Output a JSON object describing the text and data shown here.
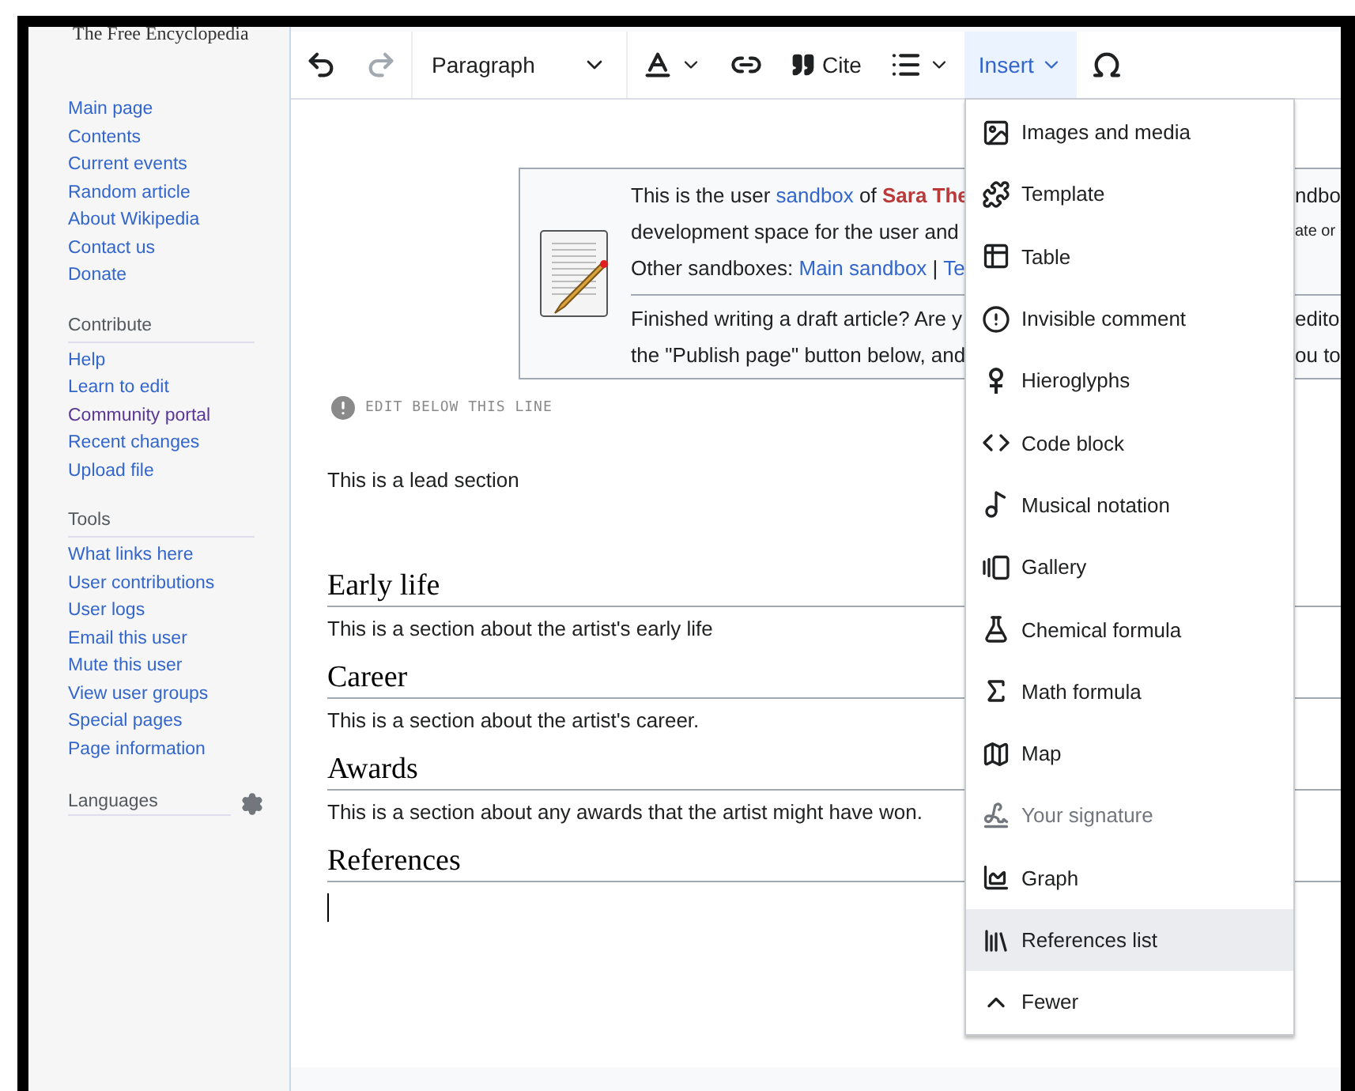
{
  "sidebar": {
    "logo_text": "The Free Encyclopedia",
    "groups": [
      {
        "items": [
          {
            "label": "Main page",
            "visited": false
          },
          {
            "label": "Contents",
            "visited": false
          },
          {
            "label": "Current events",
            "visited": false
          },
          {
            "label": "Random article",
            "visited": false
          },
          {
            "label": "About Wikipedia",
            "visited": false
          },
          {
            "label": "Contact us",
            "visited": false
          },
          {
            "label": "Donate",
            "visited": false
          }
        ]
      },
      {
        "heading": "Contribute",
        "items": [
          {
            "label": "Help",
            "visited": false
          },
          {
            "label": "Learn to edit",
            "visited": false
          },
          {
            "label": "Community portal",
            "visited": true
          },
          {
            "label": "Recent changes",
            "visited": false
          },
          {
            "label": "Upload file",
            "visited": false
          }
        ]
      },
      {
        "heading": "Tools",
        "items": [
          {
            "label": "What links here",
            "visited": false
          },
          {
            "label": "User contributions",
            "visited": false
          },
          {
            "label": "User logs",
            "visited": false
          },
          {
            "label": "Email this user",
            "visited": false
          },
          {
            "label": "Mute this user",
            "visited": false
          },
          {
            "label": "View user groups",
            "visited": false
          },
          {
            "label": "Special pages",
            "visited": false
          },
          {
            "label": "Page information",
            "visited": false
          }
        ]
      }
    ],
    "languages": {
      "heading": "Languages"
    }
  },
  "toolbar": {
    "history": [
      {
        "kind": "undo",
        "disabled": false
      },
      {
        "kind": "redo",
        "disabled": true
      }
    ],
    "format": {
      "label": "Paragraph"
    },
    "cite": {
      "label": "Cite"
    },
    "insert": {
      "label": "Insert",
      "open": true
    }
  },
  "sandbox_notice": {
    "lines": [
      {
        "divider_above": false,
        "small_right": false,
        "right": "ndbo",
        "parts": [
          {
            "kind": "text",
            "text": "This is the user "
          },
          {
            "kind": "link",
            "text": "sandbox"
          },
          {
            "kind": "text",
            "text": " of "
          },
          {
            "kind": "user",
            "text": "Sara The"
          }
        ]
      },
      {
        "divider_above": false,
        "small_right": true,
        "right": "ate or",
        "parts": [
          {
            "kind": "text",
            "text": "development space for the user and"
          }
        ]
      },
      {
        "divider_above": false,
        "parts": [
          {
            "kind": "text",
            "text": "Other sandboxes: "
          },
          {
            "kind": "link",
            "text": "Main sandbox"
          },
          {
            "kind": "text",
            "text": " | "
          },
          {
            "kind": "link",
            "text": "Te"
          }
        ]
      },
      {
        "divider_above": true,
        "small_right": false,
        "right": "edito",
        "parts": [
          {
            "kind": "text",
            "text": "Finished writing a draft article? Are y"
          }
        ]
      },
      {
        "divider_above": false,
        "small_right": false,
        "right": "ou to",
        "parts": [
          {
            "kind": "text",
            "text": "the \"Publish page\" button below, and"
          }
        ]
      }
    ]
  },
  "edit_marker": "EDIT BELOW THIS LINE",
  "lead": "This is a lead section",
  "sections": [
    {
      "heading": "Early life",
      "text": "This is a section about the artist's early life"
    },
    {
      "heading": "Career",
      "text": "This is a section about the artist's career."
    },
    {
      "heading": "Awards",
      "text": "This is a section about any awards that the artist might have won."
    },
    {
      "heading": "References"
    }
  ],
  "insert_menu": [
    {
      "label": "Images and media",
      "disabled": false,
      "highlighted": false
    },
    {
      "label": "Template",
      "disabled": false,
      "highlighted": false
    },
    {
      "label": "Table",
      "disabled": false,
      "highlighted": false
    },
    {
      "label": "Invisible comment",
      "disabled": false,
      "highlighted": false
    },
    {
      "label": "Hieroglyphs",
      "disabled": false,
      "highlighted": false
    },
    {
      "label": "Code block",
      "disabled": false,
      "highlighted": false
    },
    {
      "label": "Musical notation",
      "disabled": false,
      "highlighted": false
    },
    {
      "label": "Gallery",
      "disabled": false,
      "highlighted": false
    },
    {
      "label": "Chemical formula",
      "disabled": false,
      "highlighted": false
    },
    {
      "label": "Math formula",
      "disabled": false,
      "highlighted": false
    },
    {
      "label": "Map",
      "disabled": false,
      "highlighted": false
    },
    {
      "label": "Your signature",
      "disabled": true,
      "highlighted": false
    },
    {
      "label": "Graph",
      "disabled": false,
      "highlighted": false
    },
    {
      "label": "References list",
      "disabled": false,
      "highlighted": true
    },
    {
      "label": "Fewer",
      "disabled": false,
      "highlighted": false
    }
  ]
}
